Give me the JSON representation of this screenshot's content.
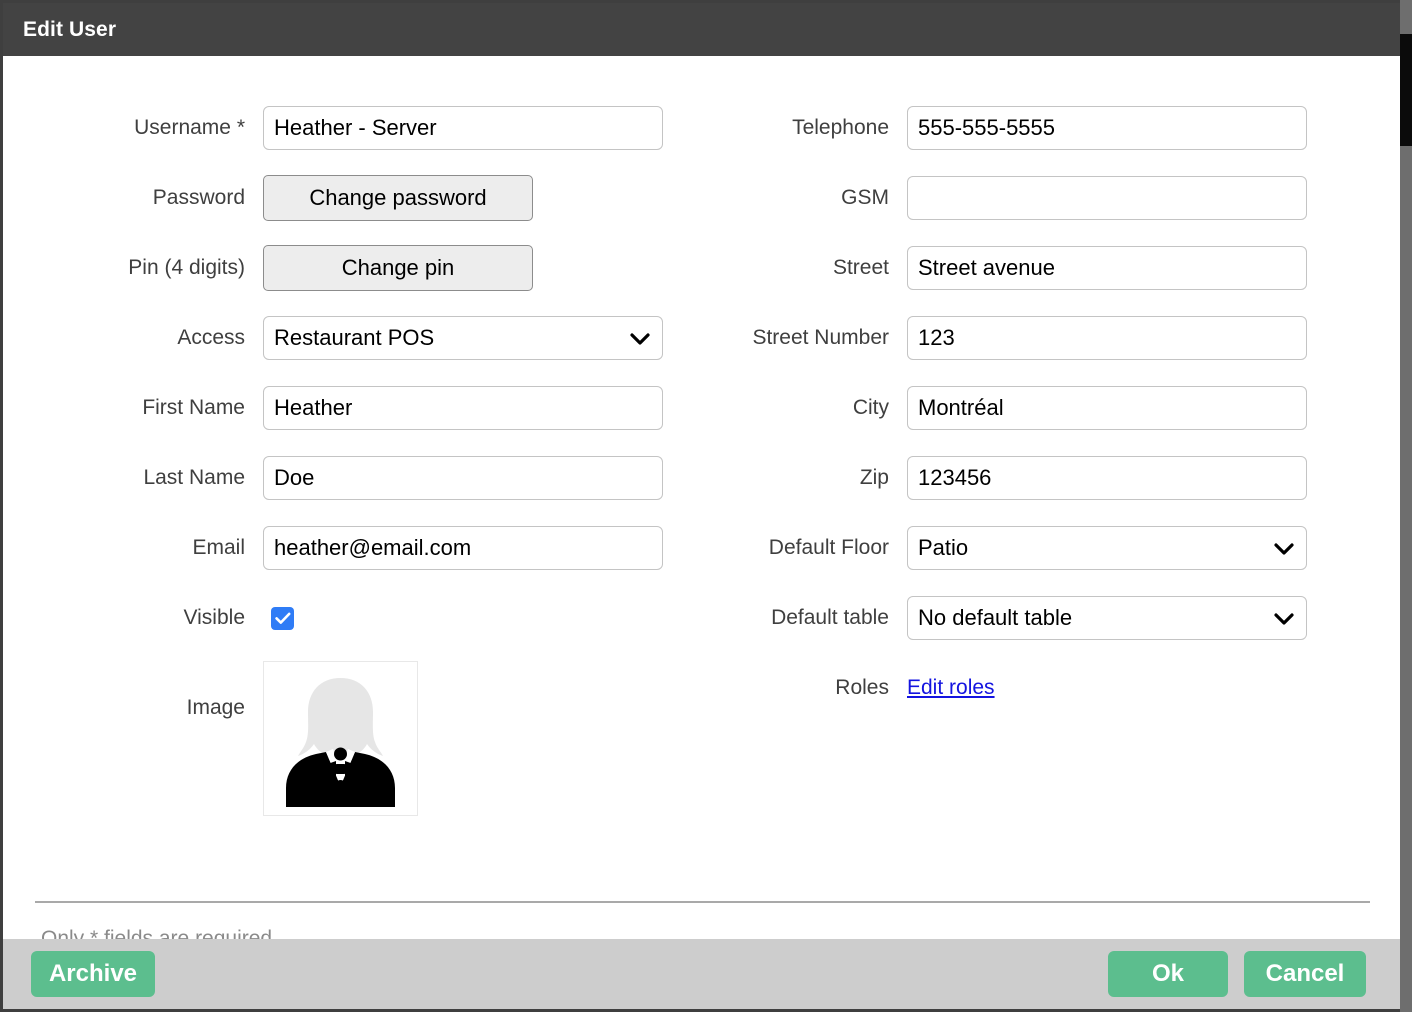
{
  "window": {
    "title": "Edit User",
    "title_bar_color": "#434343",
    "accent_green": "#5cbe8e",
    "checkbox_blue": "#2f7cf6",
    "link_blue": "#1414e0"
  },
  "form": {
    "left": [
      {
        "label": "Username *",
        "type": "text",
        "value": "Heather - Server",
        "name": "username"
      },
      {
        "label": "Password",
        "type": "button",
        "value": "Change password",
        "name": "password"
      },
      {
        "label": "Pin (4 digits)",
        "type": "button",
        "value": "Change pin",
        "name": "pin"
      },
      {
        "label": "Access",
        "type": "select",
        "value": "Restaurant POS",
        "name": "access"
      },
      {
        "label": "First Name",
        "type": "text",
        "value": "Heather",
        "name": "first-name"
      },
      {
        "label": "Last Name",
        "type": "text",
        "value": "Doe",
        "name": "last-name"
      },
      {
        "label": "Email",
        "type": "text",
        "value": "heather@email.com",
        "name": "email"
      },
      {
        "label": "Visible",
        "type": "checkbox",
        "value": "checked",
        "name": "visible"
      },
      {
        "label": "Image",
        "type": "image",
        "value": "server-avatar-icon",
        "name": "image"
      }
    ],
    "right": [
      {
        "label": "Telephone",
        "type": "text",
        "value": "555-555-5555",
        "name": "telephone"
      },
      {
        "label": "GSM",
        "type": "text",
        "value": "",
        "name": "gsm"
      },
      {
        "label": "Street",
        "type": "text",
        "value": "Street avenue",
        "name": "street"
      },
      {
        "label": "Street Number",
        "type": "text",
        "value": "123",
        "name": "street-number"
      },
      {
        "label": "City",
        "type": "text",
        "value": "Montréal",
        "name": "city"
      },
      {
        "label": "Zip",
        "type": "text",
        "value": "123456",
        "name": "zip"
      },
      {
        "label": "Default Floor",
        "type": "select",
        "value": "Patio",
        "name": "default-floor"
      },
      {
        "label": "Default table",
        "type": "select",
        "value": "No default table",
        "name": "default-table"
      },
      {
        "label": "Roles",
        "type": "link",
        "value": "Edit roles",
        "name": "roles"
      }
    ]
  },
  "footer": {
    "note": "Only * fields are required",
    "archive_label": "Archive",
    "ok_label": "Ok",
    "cancel_label": "Cancel"
  }
}
